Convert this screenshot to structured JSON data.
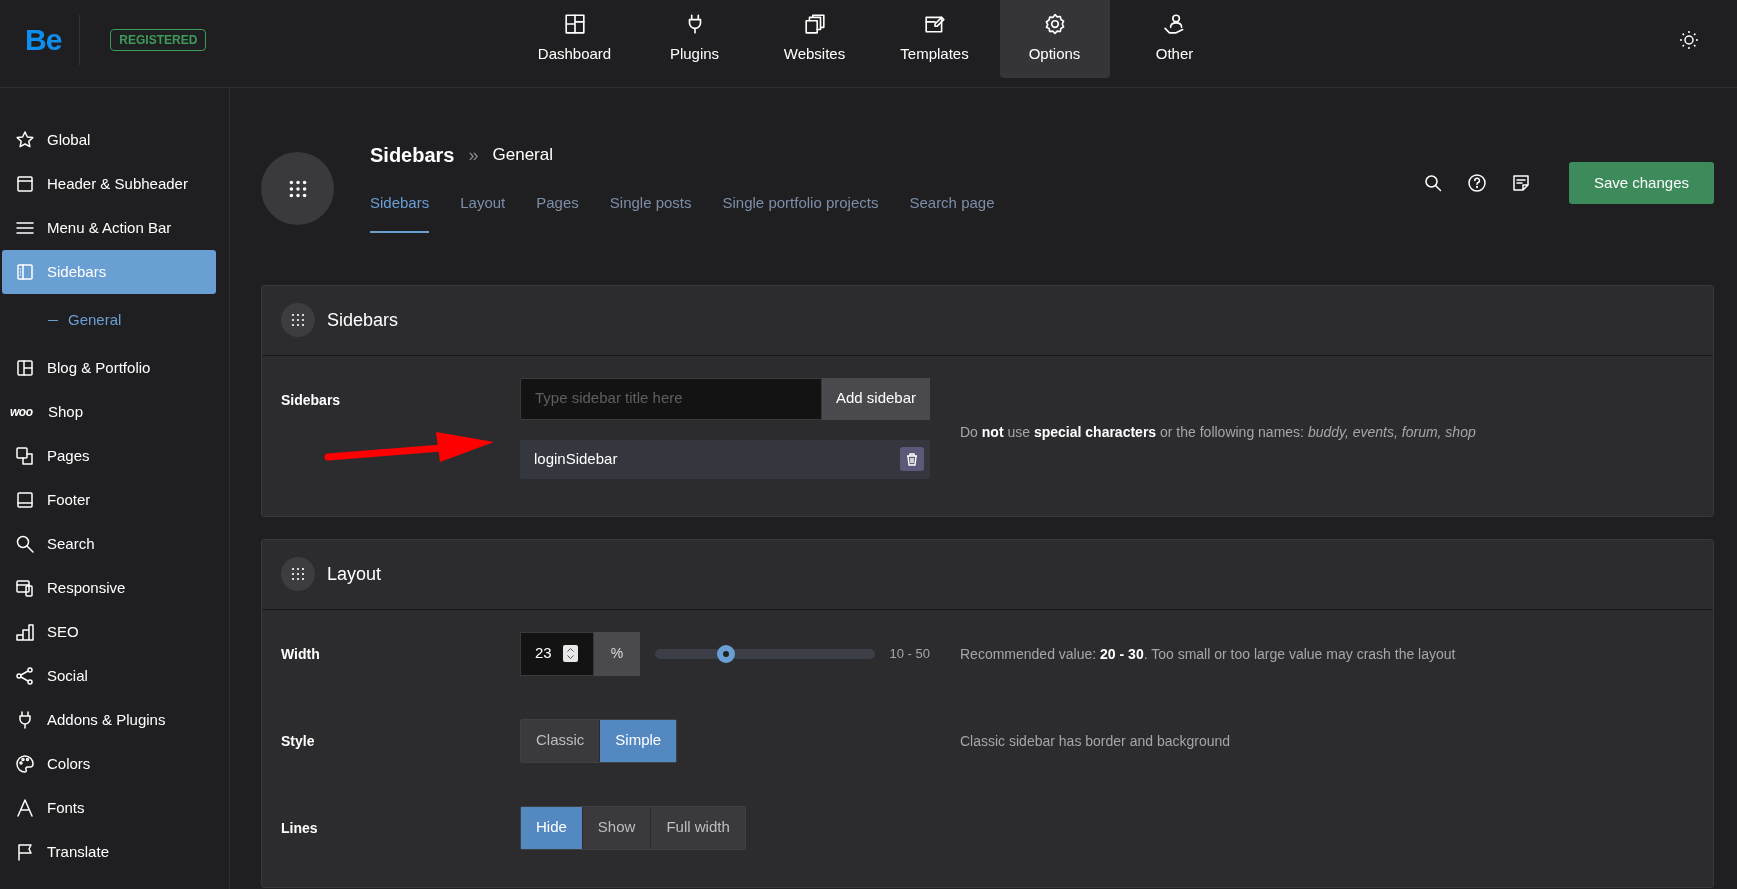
{
  "logo": "Be",
  "license_badge": "REGISTERED",
  "top_nav": [
    {
      "label": "Dashboard",
      "selected": false
    },
    {
      "label": "Plugins",
      "selected": false
    },
    {
      "label": "Websites",
      "selected": false
    },
    {
      "label": "Templates",
      "selected": false
    },
    {
      "label": "Options",
      "selected": true
    },
    {
      "label": "Other",
      "selected": false
    }
  ],
  "sidebar": {
    "items": [
      {
        "label": "Global",
        "selected": false
      },
      {
        "label": "Header & Subheader",
        "selected": false
      },
      {
        "label": "Menu & Action Bar",
        "selected": false
      },
      {
        "label": "Sidebars",
        "selected": true,
        "children": [
          {
            "label": "General",
            "selected": true
          }
        ]
      },
      {
        "label": "Blog & Portfolio",
        "selected": false
      },
      {
        "label": "Shop",
        "icon_text": "woo",
        "selected": false
      },
      {
        "label": "Pages",
        "selected": false
      },
      {
        "label": "Footer",
        "selected": false
      },
      {
        "label": "Search",
        "selected": false
      },
      {
        "label": "Responsive",
        "selected": false
      },
      {
        "label": "SEO",
        "selected": false
      },
      {
        "label": "Social",
        "selected": false
      },
      {
        "label": "Addons & Plugins",
        "selected": false
      },
      {
        "label": "Colors",
        "selected": false
      },
      {
        "label": "Fonts",
        "selected": false
      },
      {
        "label": "Translate",
        "selected": false
      }
    ]
  },
  "page_header": {
    "title": "Sidebars",
    "separator": "»",
    "subtitle": "General",
    "tabs": [
      {
        "label": "Sidebars",
        "selected": true
      },
      {
        "label": "Layout",
        "selected": false
      },
      {
        "label": "Pages",
        "selected": false
      },
      {
        "label": "Single posts",
        "selected": false
      },
      {
        "label": "Single portfolio projects",
        "selected": false
      },
      {
        "label": "Search page",
        "selected": false
      }
    ]
  },
  "save_button": "Save changes",
  "sections": [
    {
      "title": "Sidebars",
      "rows": [
        {
          "kind": "sidebar_list",
          "label": "Sidebars",
          "placeholder": "Type sidebar title here",
          "add_button": "Add sidebar",
          "items": [
            "loginSidebar"
          ],
          "help": "Do **not** use **special characters** or the following names: *buddy, events, forum, shop*"
        }
      ]
    },
    {
      "title": "Layout",
      "rows": [
        {
          "kind": "number_slider",
          "label": "Width",
          "value": "23",
          "unit": "%",
          "level": 0.325,
          "range": "10 - 50",
          "help": "Recommended value: **20 - 30**. Too small or too large value may crash the layout"
        },
        {
          "kind": "button_group",
          "label": "Style",
          "options": [
            {
              "label": "Classic",
              "selected": false
            },
            {
              "label": "Simple",
              "selected": true
            }
          ],
          "help": "Classic sidebar has border and background"
        },
        {
          "kind": "button_group",
          "label": "Lines",
          "options": [
            {
              "label": "Hide",
              "selected": true
            },
            {
              "label": "Show",
              "selected": false
            },
            {
              "label": "Full width",
              "selected": false
            }
          ]
        }
      ]
    }
  ]
}
